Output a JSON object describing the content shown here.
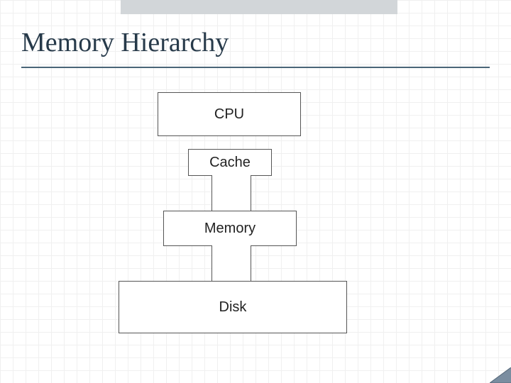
{
  "title": "Memory Hierarchy",
  "diagram": {
    "boxes": {
      "cpu": {
        "label": "CPU"
      },
      "cache": {
        "label": "Cache"
      },
      "memory": {
        "label": "Memory"
      },
      "disk": {
        "label": "Disk"
      }
    }
  },
  "colors": {
    "title": "#273a4a",
    "rule": "#4a6678",
    "border": "#555555",
    "grid": "#f0f0f0",
    "topfade": "#d2d6d9"
  }
}
